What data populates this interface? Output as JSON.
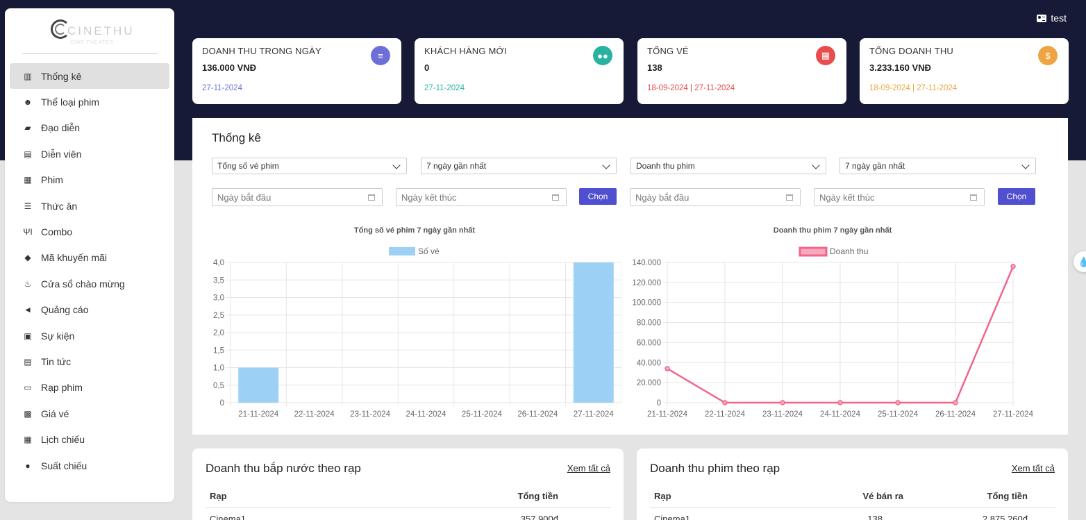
{
  "user": {
    "name": "test"
  },
  "brand": {
    "name": "CINETHU",
    "tagline": "CINE THEATER"
  },
  "sidebar": {
    "items": [
      {
        "label": "Thống kê",
        "icon": "chart-bar-icon",
        "glyph": "▥"
      },
      {
        "label": "Thể loại phim",
        "icon": "theater-masks-icon",
        "glyph": "☻"
      },
      {
        "label": "Đạo diễn",
        "icon": "clapperboard-icon",
        "glyph": "▰"
      },
      {
        "label": "Diễn viên",
        "icon": "id-card-icon",
        "glyph": "▤"
      },
      {
        "label": "Phim",
        "icon": "film-icon",
        "glyph": "▦"
      },
      {
        "label": "Thức ăn",
        "icon": "burger-icon",
        "glyph": "☰"
      },
      {
        "label": "Combo",
        "icon": "utensils-icon",
        "glyph": "ΨΙ"
      },
      {
        "label": "Mã khuyến mãi",
        "icon": "tag-icon",
        "glyph": "◆"
      },
      {
        "label": "Cửa sổ chào mừng",
        "icon": "fire-icon",
        "glyph": "♨"
      },
      {
        "label": "Quảng cáo",
        "icon": "megaphone-icon",
        "glyph": "◄"
      },
      {
        "label": "Sự kiện",
        "icon": "calendar-check-icon",
        "glyph": "▣"
      },
      {
        "label": "Tin tức",
        "icon": "newspaper-icon",
        "glyph": "▤"
      },
      {
        "label": "Rạp phim",
        "icon": "monitor-icon",
        "glyph": "▭"
      },
      {
        "label": "Giá vé",
        "icon": "money-bill-icon",
        "glyph": "▩"
      },
      {
        "label": "Lịch chiếu",
        "icon": "calendar-icon",
        "glyph": "▦"
      },
      {
        "label": "Suất chiếu",
        "icon": "stopwatch-icon",
        "glyph": "●"
      }
    ]
  },
  "cards": [
    {
      "title": "DOANH THU TRONG NGÀY",
      "value": "136.000 VNĐ",
      "date": "27-11-2024",
      "color": "#6c6fd8",
      "icon": "coins-icon",
      "glyph": "≡"
    },
    {
      "title": "KHÁCH HÀNG MỚI",
      "value": "0",
      "date": "27-11-2024",
      "color": "#27b3a0",
      "icon": "users-icon",
      "glyph": "●●"
    },
    {
      "title": "TỔNG VÉ",
      "value": "138",
      "date": "18-09-2024 | 27-11-2024",
      "color": "#e84c4c",
      "icon": "calculator-icon",
      "glyph": "▦"
    },
    {
      "title": "TỔNG DOANH THU",
      "value": "3.233.160 VNĐ",
      "date": "18-09-2024 | 27-11-2024",
      "color": "#eea541",
      "icon": "money-bag-icon",
      "glyph": "$"
    }
  ],
  "stats": {
    "title": "Thống kê",
    "filters": {
      "left_metric": "Tổng số vé phim",
      "left_range": "7 ngày gần nhất",
      "right_metric": "Doanh thu phim",
      "right_range": "7 ngày gần nhất",
      "start_placeholder": "Ngày bắt đầu",
      "end_placeholder": "Ngày kết thúc",
      "choose_label": "Chọn"
    }
  },
  "chart_data": [
    {
      "type": "bar",
      "title": "Tổng số vé phim 7 ngày gần nhất",
      "categories": [
        "21-11-2024",
        "22-11-2024",
        "23-11-2024",
        "24-11-2024",
        "25-11-2024",
        "26-11-2024",
        "27-11-2024"
      ],
      "series": [
        {
          "name": "Số vé",
          "values": [
            1,
            0,
            0,
            0,
            0,
            0,
            4
          ],
          "color": "#9dd0f5"
        }
      ],
      "ylim": [
        0,
        4
      ],
      "yticks": [
        "0",
        "0,5",
        "1,0",
        "1,5",
        "2,0",
        "2,5",
        "3,0",
        "3,5",
        "4,0"
      ],
      "legend": "top",
      "grid": true
    },
    {
      "type": "line",
      "title": "Doanh thu phim 7 ngày gần nhất",
      "categories": [
        "21-11-2024",
        "22-11-2024",
        "23-11-2024",
        "24-11-2024",
        "25-11-2024",
        "26-11-2024",
        "27-11-2024"
      ],
      "series": [
        {
          "name": "Doanh thu",
          "values": [
            34000,
            0,
            0,
            0,
            0,
            0,
            136000
          ],
          "color": "#f2658a"
        }
      ],
      "ylim": [
        0,
        140000
      ],
      "yticks": [
        "0",
        "20.000",
        "40.000",
        "60.000",
        "80.000",
        "100.000",
        "120.000",
        "140.000"
      ],
      "legend": "top",
      "grid": true
    }
  ],
  "tables": {
    "snacks": {
      "title": "Doanh thu bắp nước theo rạp",
      "more": "Xem tất cả",
      "headers": [
        "Rạp",
        "Tổng tiền"
      ],
      "rows": [
        [
          "Cinema1",
          "357.900đ"
        ]
      ]
    },
    "movies": {
      "title": "Doanh thu phim theo rạp",
      "more": "Xem tất cả",
      "headers": [
        "Rạp",
        "Vé bán ra",
        "Tổng tiền"
      ],
      "rows": [
        [
          "Cinema1",
          "138",
          "2.875.260đ"
        ]
      ]
    }
  }
}
